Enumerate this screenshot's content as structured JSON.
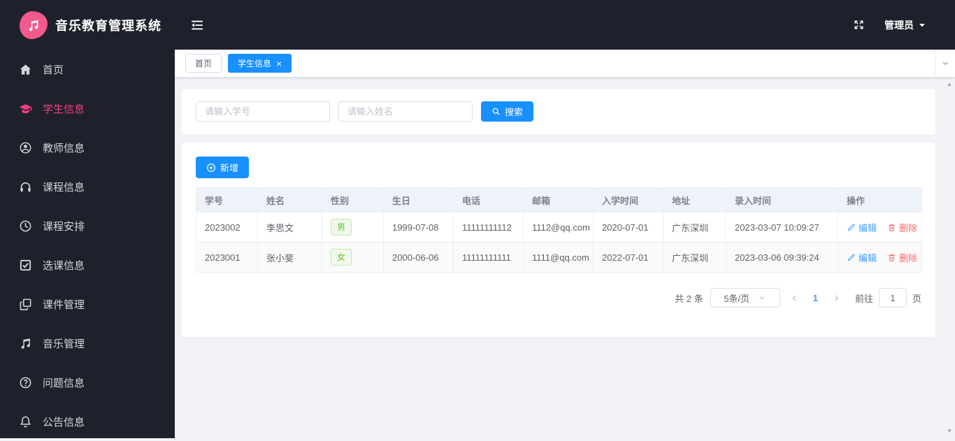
{
  "app": {
    "title": "音乐教育管理系统",
    "admin_label": "管理员"
  },
  "sidebar": {
    "items": [
      {
        "label": "首页",
        "icon": "home-icon",
        "active": false
      },
      {
        "label": "学生信息",
        "icon": "graduation-cap-icon",
        "active": true
      },
      {
        "label": "教师信息",
        "icon": "user-icon",
        "active": false
      },
      {
        "label": "课程信息",
        "icon": "headphones-icon",
        "active": false
      },
      {
        "label": "课程安排",
        "icon": "clock-icon",
        "active": false
      },
      {
        "label": "选课信息",
        "icon": "checkbox-icon",
        "active": false
      },
      {
        "label": "课件管理",
        "icon": "copy-icon",
        "active": false
      },
      {
        "label": "音乐管理",
        "icon": "music-note-icon",
        "active": false
      },
      {
        "label": "问题信息",
        "icon": "question-icon",
        "active": false
      },
      {
        "label": "公告信息",
        "icon": "bell-icon",
        "active": false
      }
    ]
  },
  "tabs": [
    {
      "label": "首页",
      "active": false,
      "closable": false
    },
    {
      "label": "学生信息",
      "active": true,
      "closable": true
    }
  ],
  "search": {
    "student_id_placeholder": "请输入学号",
    "name_placeholder": "请输入姓名",
    "search_label": "搜索"
  },
  "toolbar": {
    "add_label": "新增"
  },
  "table": {
    "headers": [
      "学号",
      "姓名",
      "性别",
      "生日",
      "电话",
      "邮箱",
      "入学时间",
      "地址",
      "录入时间",
      "操作"
    ],
    "rows": [
      {
        "student_id": "2023002",
        "name": "李思文",
        "gender": "男",
        "birthday": "1999-07-08",
        "phone": "11111111112",
        "email": "1112@qq.com",
        "enroll_date": "2020-07-01",
        "address": "广东深圳",
        "created_at": "2023-03-07 10:09:27"
      },
      {
        "student_id": "2023001",
        "name": "张小斐",
        "gender": "女",
        "birthday": "2000-06-06",
        "phone": "11111111111",
        "email": "1111@qq.com",
        "enroll_date": "2022-07-01",
        "address": "广东深圳",
        "created_at": "2023-03-06 09:39:24"
      }
    ],
    "edit_label": "编辑",
    "delete_label": "删除"
  },
  "pagination": {
    "total_label": "共 2 条",
    "page_size": "5条/页",
    "current_page": "1",
    "goto_label": "前往",
    "goto_value": "1",
    "page_unit": "页"
  },
  "colors": {
    "header_sidebar_bg": "#1e212b",
    "logo_pink": "#f2598c",
    "active_menu_pink": "#f43f7f",
    "primary_blue": "#1890ff",
    "link_blue": "#409eff",
    "success_green": "#67c23a",
    "danger_red": "#f56c6c",
    "content_bg": "#f0f2f5",
    "table_header_bg": "#eef3f9"
  }
}
